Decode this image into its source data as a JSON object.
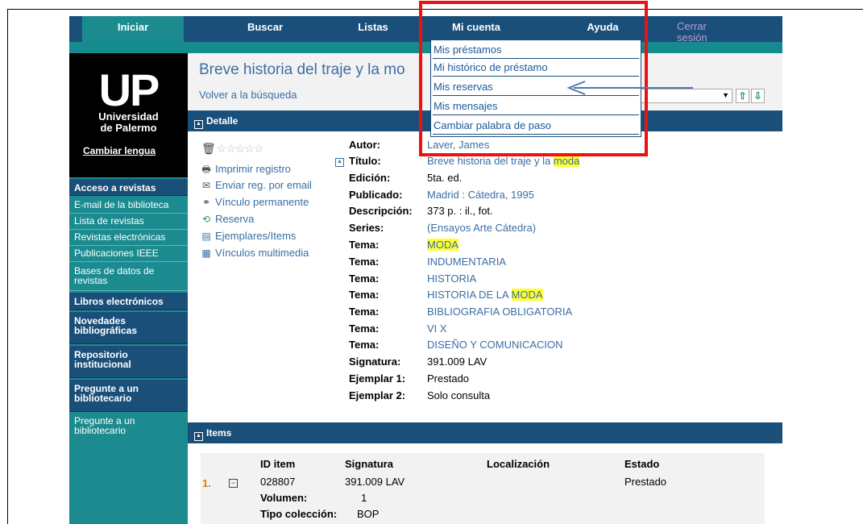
{
  "nav": {
    "tabs": [
      "Iniciar",
      "Buscar",
      "Listas",
      "Mi cuenta",
      "Ayuda"
    ],
    "logout": "Cerrar sesión"
  },
  "logo": {
    "big": "UP",
    "line1": "Universidad",
    "line2": "de Palermo"
  },
  "sidebar": {
    "lang": "Cambiar lengua",
    "items": [
      "Acceso a revistas",
      "E-mail de la biblioteca",
      "Lista de revistas",
      "Revistas electrónicas",
      "Publicaciones IEEE",
      "Bases de datos de revistas",
      "Libros electrónicos",
      "Novedades bibliográficas",
      "Repositorio institucional",
      "Pregunte a un bibliotecario",
      "Pregunte a un bibliotecario"
    ]
  },
  "header": {
    "title": "Breve historia del traje y la mo",
    "back": "Volver a la búsqueda"
  },
  "sections": {
    "detail": "Detalle",
    "items": "Items"
  },
  "actions": [
    "Imprimir registro",
    "Enviar reg. por email",
    "Vínculo permanente",
    "Reserva",
    "Ejemplares/Items",
    "Vínculos multimedia"
  ],
  "icons": {
    "trash": "trash-icon",
    "star": "star-icon",
    "print": "print-icon",
    "email": "email-icon",
    "link": "link-icon",
    "reserve": "reserve-icon",
    "items": "items-icon",
    "multimedia": "multimedia-icon"
  },
  "record": {
    "fields": [
      {
        "label": "Autor:",
        "value": "Laver, James"
      },
      {
        "label": "Título:",
        "value": "Breve historia del traje y la ",
        "hl": "moda"
      },
      {
        "label": "Edición:",
        "value": "5ta. ed."
      },
      {
        "label": "Publicado:",
        "value": "Madrid : Cátedra, 1995"
      },
      {
        "label": "Descripción:",
        "value": "373 p. : il., fot."
      },
      {
        "label": "Series:",
        "value": "(Ensayos Arte Cátedra)"
      },
      {
        "label": "Tema:",
        "value": "",
        "hl": "MODA"
      },
      {
        "label": "Tema:",
        "value": "INDUMENTARIA"
      },
      {
        "label": "Tema:",
        "value": "HISTORIA"
      },
      {
        "label": "Tema:",
        "value": "HISTORIA DE LA ",
        "hl": "MODA"
      },
      {
        "label": "Tema:",
        "value": "BIBLIOGRAFIA OBLIGATORIA"
      },
      {
        "label": "Tema:",
        "value": "VI X"
      },
      {
        "label": "Tema:",
        "value": "DISEÑO Y COMUNICACION"
      },
      {
        "label": "Signatura:",
        "value": "391.009 LAV"
      },
      {
        "label": "Ejemplar 1:",
        "value": "Prestado"
      },
      {
        "label": "Ejemplar 2:",
        "value": "Solo consulta"
      }
    ]
  },
  "items_table": {
    "headers": [
      "ID item",
      "Signatura",
      "Localización",
      "Estado"
    ],
    "row": {
      "num": "1.",
      "id": "028807",
      "signatura": "391.009 LAV",
      "estado": "Prestado",
      "volumen_label": "Volumen:",
      "volumen": "1",
      "tipo_label": "Tipo colección:",
      "tipo": "BOP"
    }
  },
  "dropdown": {
    "items": [
      "Mis préstamos",
      "Mi histórico de préstamo",
      "Mis reservas",
      "Mis mensajes",
      "Cambiar palabra de paso"
    ]
  },
  "colors": {
    "nav": "#1a4f7a",
    "teal": "#1b8b90",
    "link": "#3a6ea5",
    "highlight": "#ffff33",
    "annotation": "#ee1111"
  }
}
